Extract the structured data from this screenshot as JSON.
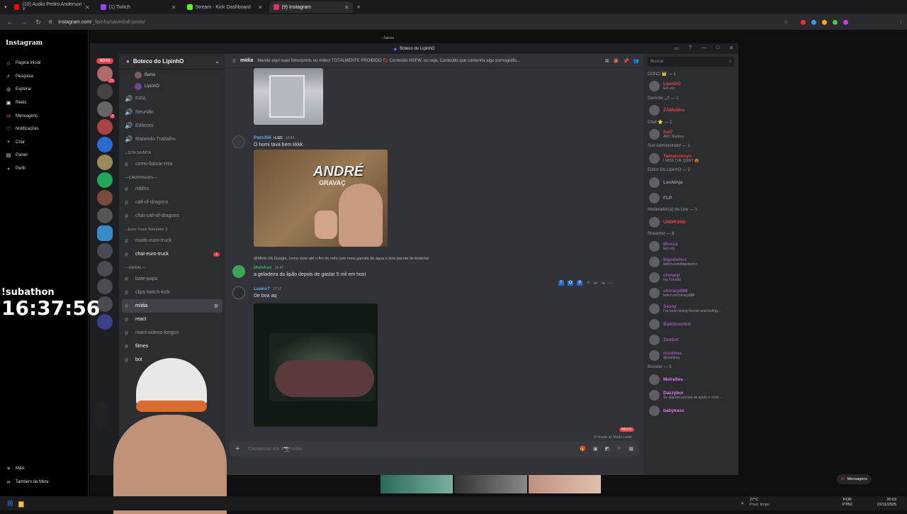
{
  "browser": {
    "tabs": [
      {
        "label": "(10) Audio Pedro Anderson - Y",
        "color": "#ff0000"
      },
      {
        "label": "(1) Twitch",
        "color": "#9146ff"
      },
      {
        "label": "Stream - Kick Dashboard",
        "color": "#53fc18"
      },
      {
        "label": "(9) Instagram",
        "color": "#e1306c"
      }
    ],
    "url_host": "instagram.com",
    "url_path": "/_lipinho/saved/all-posts/"
  },
  "instagram": {
    "logo": "Instagram",
    "nav": [
      {
        "label": "Página inicial",
        "icon": "home-icon",
        "glyph": "⌂"
      },
      {
        "label": "Pesquisa",
        "icon": "search-icon",
        "glyph": "⌕"
      },
      {
        "label": "Explorar",
        "icon": "compass-icon",
        "glyph": "◎"
      },
      {
        "label": "Reels",
        "icon": "reels-icon",
        "glyph": "▣"
      },
      {
        "label": "Mensagens",
        "icon": "messages-icon",
        "glyph": "✉"
      },
      {
        "label": "Notificações",
        "icon": "heart-icon",
        "glyph": "♡"
      },
      {
        "label": "Criar",
        "icon": "plus-icon",
        "glyph": "+"
      },
      {
        "label": "Painel",
        "icon": "dashboard-icon",
        "glyph": "▤"
      },
      {
        "label": "Perfil",
        "icon": "profile-icon",
        "glyph": "●"
      }
    ],
    "more": "Mais",
    "meta": "Também da Meta",
    "saved_label": "Salvos",
    "messages_pill": "Mensagens"
  },
  "discord": {
    "window_title": "Boteco do LipinhO",
    "server_name": "Boteco do LipinhO",
    "novo": "NOVO",
    "voice_users": [
      "Bahia",
      "LipinhO"
    ],
    "voice_channels": [
      "FIFA",
      "Reunião",
      "Editores",
      "Matando-Trabalho"
    ],
    "categories": {
      "gta": "GTA SA/MTA",
      "campanhas": "CAMPANHAS",
      "euro": "Euro Truck Simulator 2",
      "geral": "GERAL"
    },
    "channels": {
      "como_baixar": "como-baixar-mta",
      "roblox": "roblox",
      "call_dragons": "call-of-dragons",
      "chat_dragons": "chat-call-of-dragons",
      "mods_euro": "mods-euro-truck",
      "chat_euro": "chat-euro-truck",
      "bate_papo": "bate-papo",
      "clips": "clips-twitch-kick",
      "midia": "mídia",
      "react": "react",
      "react_longos": "react-videos-longos",
      "filmes": "filmes",
      "bot": "bot"
    },
    "header_channel": "mídia",
    "header_topic": "Mande aqui suas fotos/prints ou vídeo! TOTALMENTE PROIBIDO 🚫 Conteúdo NSFW, ou seja, Conteúdo que contenha algo pornográfic...",
    "messages": [
      {
        "name": "Polo355",
        "tag": "LGC",
        "time": "10:44",
        "text": "O homi tava bem kkkk",
        "color": "#5dadec"
      },
      {
        "reply": "@Mlolo Ok Google, como viver até o fim do mês com meia garrafa de água e dois pacote de bolacha",
        "name": "Matekas",
        "time": "16:47",
        "text": "a geladeira do lipão depois de gastar 5 mil em host",
        "color": "#3ba55c"
      },
      {
        "name": "Luanx7",
        "time": "17:17",
        "text": "De boa aq",
        "color": "#5dadec"
      }
    ],
    "image_text": "ANDRÉ",
    "image_subtext": "GRAVAÇ",
    "composer_placeholder": "Conversar em #📷mídia",
    "slowmode": "Imune ao Modo Lento",
    "new_badge": "NOVO",
    "search_placeholder": "Buscar",
    "members": [
      {
        "role": "DONO 👑 — 1",
        "users": [
          {
            "name": "LipinhO",
            "sub": "Em voz",
            "color": "#f23f43"
          }
        ]
      },
      {
        "role": "Gerente 🌶 — 1",
        "users": [
          {
            "name": "ZAMudhu",
            "sub": "",
            "color": "#f23f43"
          }
        ]
      },
      {
        "role": "Chef ⭐ — 1",
        "users": [
          {
            "name": "Sal7",
            "sub": "ARC Raiders",
            "color": "#f23f43"
          }
        ]
      },
      {
        "role": "Sub Administrator — 1",
        "users": [
          {
            "name": "Tamanonuyo",
            "sub": "I MISS THE QUIET 🎃",
            "color": "#f23f43"
          }
        ]
      },
      {
        "role": "Editor Do LipinhO — 2",
        "users": [
          {
            "name": "LeoNinja",
            "sub": "",
            "color": "#949ba4"
          },
          {
            "name": "FLP",
            "sub": "",
            "color": "#949ba4"
          }
        ]
      },
      {
        "role": "Moderador(a) de Live — 1",
        "users": [
          {
            "name": "UNDR3ND",
            "sub": "",
            "color": "#f23f43"
          }
        ]
      },
      {
        "role": "Streamer — 8",
        "users": [
          {
            "name": "Mosca",
            "sub": "Em voz",
            "color": "#9b59b6"
          },
          {
            "name": "bigodemcr",
            "sub": "twitch.com/bigodemcr",
            "color": "#9b59b6"
          },
          {
            "name": "chinarp",
            "sub": "my Friends",
            "color": "#9b59b6"
          },
          {
            "name": "chinarp088",
            "sub": "twitch.tv/chinarp088",
            "color": "#9b59b6"
          },
          {
            "name": "Sassy",
            "sub": "I've been losing friends and finding...",
            "color": "#9b59b6"
          },
          {
            "name": "Bamboozled",
            "sub": "",
            "color": "#9b59b6"
          },
          {
            "name": "Zenbot",
            "sub": "",
            "color": "#9b59b6"
          },
          {
            "name": "roudima",
            "sub": "@roudima",
            "color": "#9b59b6"
          }
        ]
      },
      {
        "role": "Booster — 5",
        "users": [
          {
            "name": "Meirelles",
            "sub": "",
            "color": "#e879f9"
          },
          {
            "name": "Dazzyboi",
            "sub": "Se alguém precisa de ajuda e você...",
            "color": "#e879f9"
          },
          {
            "name": "babykass",
            "sub": "",
            "color": "#e879f9"
          }
        ]
      }
    ]
  },
  "overlay": {
    "subathon": "!subathon",
    "timer": "16:37:56"
  },
  "taskbar": {
    "weather_temp": "27°C",
    "weather_desc": "Pred. limpo",
    "lang": "POR",
    "layout": "PTB2",
    "time": "20:03",
    "date": "22/11/2025"
  }
}
